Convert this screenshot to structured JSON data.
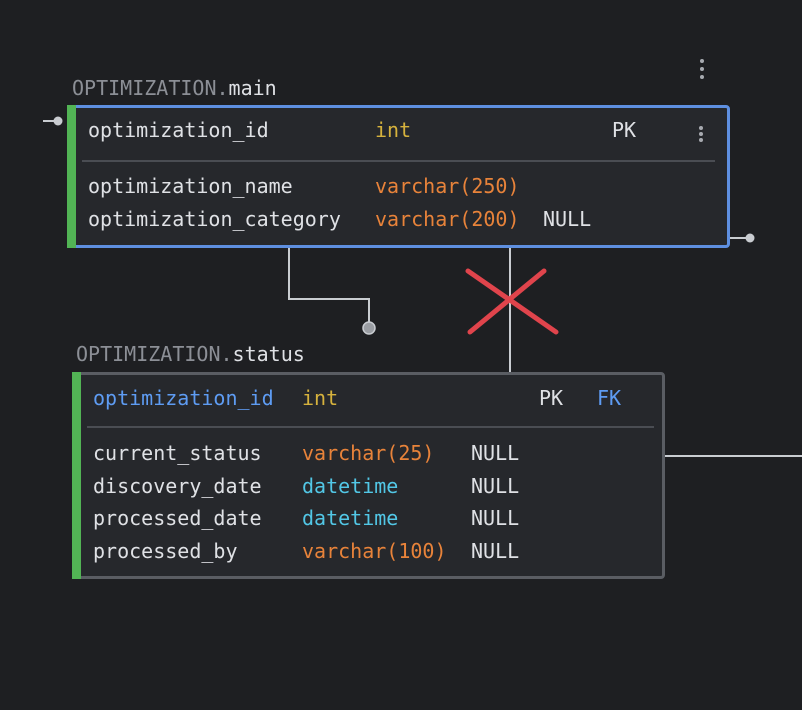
{
  "tables": [
    {
      "schema": "OPTIMIZATION.",
      "name": "main",
      "primary_column": {
        "name": "optimization_id",
        "type": "int",
        "nullable": "",
        "pk": "PK",
        "fk": ""
      },
      "columns": [
        {
          "name": "optimization_name",
          "type": "varchar(250)",
          "nullable": ""
        },
        {
          "name": "optimization_category",
          "type": "varchar(200)",
          "nullable": "NULL"
        }
      ],
      "selected": true
    },
    {
      "schema": "OPTIMIZATION.",
      "name": "status",
      "primary_column": {
        "name": "optimization_id",
        "type": "int",
        "nullable": "",
        "pk": "PK",
        "fk": "FK"
      },
      "columns": [
        {
          "name": "current_status",
          "type": "varchar(25)",
          "nullable": "NULL"
        },
        {
          "name": "discovery_date",
          "type": "datetime",
          "nullable": "NULL"
        },
        {
          "name": "processed_date",
          "type": "datetime",
          "nullable": "NULL"
        },
        {
          "name": "processed_by",
          "type": "varchar(100)",
          "nullable": "NULL"
        }
      ],
      "selected": false
    }
  ],
  "icons": {
    "menu": "kebab-menu-icon",
    "delete_relation": "cross-icon"
  },
  "colors": {
    "background": "#1e1f22",
    "selected_border": "#5e8fe0",
    "accent_bar": "#52b455",
    "int_type": "#d6b23d",
    "varchar_type": "#e8833a",
    "datetime_type": "#52c7e6",
    "key_column": "#5e9cf3",
    "delete_mark": "#e0444c"
  }
}
